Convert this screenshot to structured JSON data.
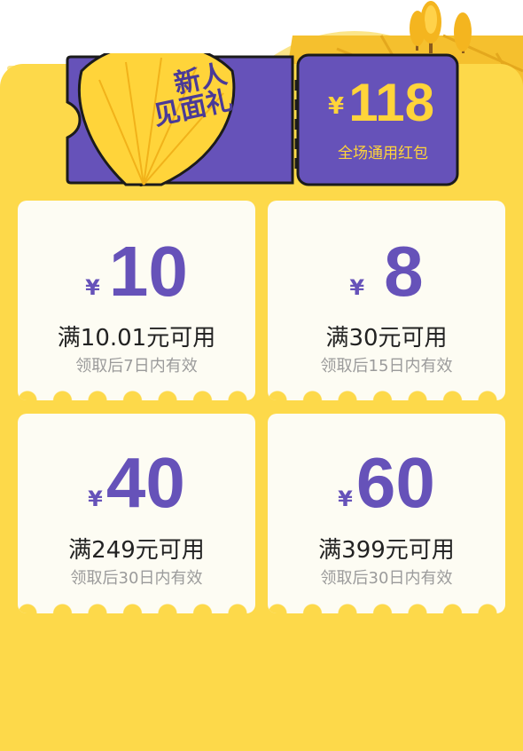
{
  "banner": {
    "leaf_text_line1": "新人",
    "leaf_text_line2": "见面礼",
    "yen_symbol": "¥",
    "total_amount": "118",
    "subtitle": "全场通用红包"
  },
  "coupons": [
    {
      "yen": "¥",
      "amount": "10",
      "condition": "满10.01元可用",
      "validity": "领取后7日内有效"
    },
    {
      "yen": "¥",
      "amount": "8",
      "condition": "满30元可用",
      "validity": "领取后15日内有效"
    },
    {
      "yen": "¥",
      "amount": "40",
      "condition": "满249元可用",
      "validity": "领取后30日内有效"
    },
    {
      "yen": "¥",
      "amount": "60",
      "condition": "满399元可用",
      "validity": "领取后30日内有效"
    }
  ],
  "colors": {
    "accent_purple": "#6652b9",
    "background_yellow": "#fdd94a",
    "coupon_bg": "#fdfcf3",
    "gold_text": "#ffd43a"
  },
  "icons": [
    "ginkgo-leaf-icon",
    "tree-icon"
  ]
}
